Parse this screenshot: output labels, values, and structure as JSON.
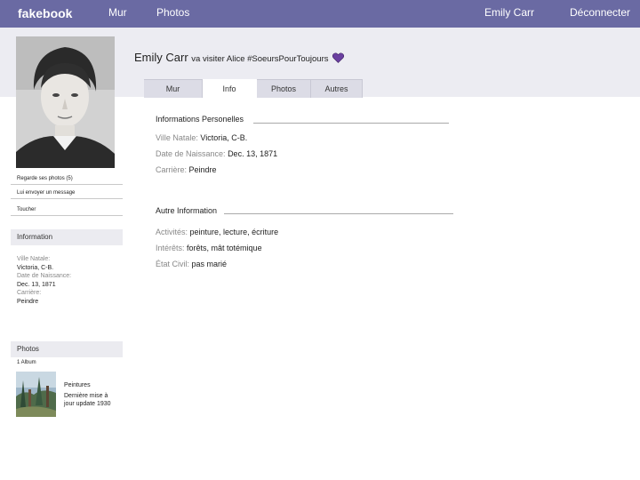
{
  "topbar": {
    "logo": "fakebook",
    "wall": "Mur",
    "photos": "Photos",
    "user": "Emily Carr",
    "logout": "Déconnecter"
  },
  "status": {
    "name": "Emily Carr",
    "text": "va visiter Alice #SoeursPourToujours"
  },
  "tabs": [
    {
      "label": "Mur"
    },
    {
      "label": "Info"
    },
    {
      "label": "Photos"
    },
    {
      "label": "Autres"
    }
  ],
  "sidebar": {
    "see_photos": "Regarde ses photos (5)",
    "send_message": "Lui envoyer un message",
    "poke": "Toucher",
    "info_header": "Information",
    "info_items": [
      {
        "label": "Ville Natale:",
        "value": "Victoria, C-B."
      },
      {
        "label": "Date de Naissance:",
        "value": "Dec. 13, 1871"
      },
      {
        "label": "Carrière:",
        "value": "Peindre"
      }
    ],
    "photos_header": "Photos",
    "album_count": "1 Album",
    "album_name": "Peintures",
    "album_updated": "Dernière mise à jour update 1930"
  },
  "personal": {
    "title": "Informations Personelles",
    "hometown_label": "Ville Natale:",
    "hometown": "Victoria, C-B.",
    "birthday_label": "Date de Naissance:",
    "birthday": "Dec. 13, 1871",
    "career_label": "Carrière:",
    "career": "Peindre"
  },
  "other": {
    "title": "Autre Information",
    "activities_label": "Activités:",
    "activities": "peinture, lecture, écriture",
    "interests_label": "Intérêts:",
    "interests": "forêts, mât totémique",
    "civil_label": "État Civil:",
    "civil": "pas marié"
  },
  "colors": {
    "topbar": "#6a6aa3",
    "header_band": "#ececf2",
    "heart": "#6a3fa0"
  }
}
